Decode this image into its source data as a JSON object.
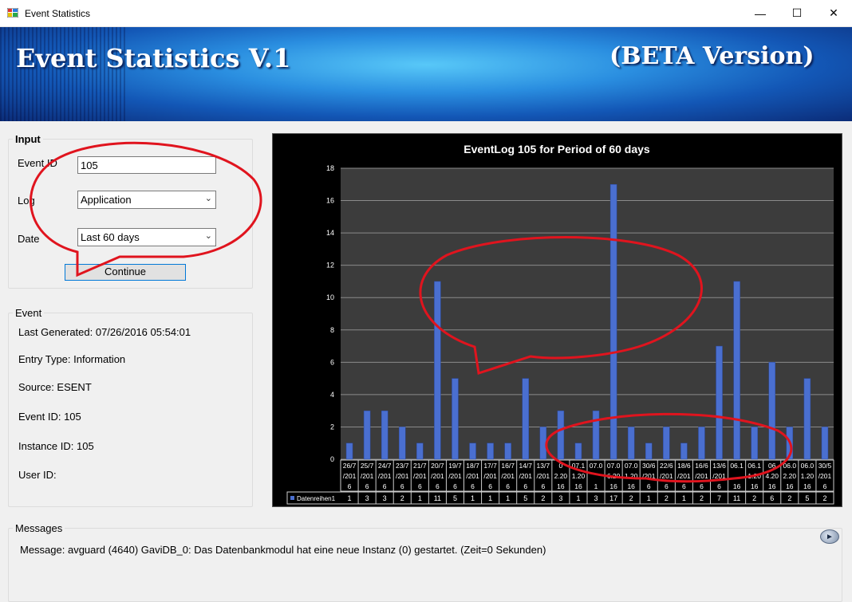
{
  "window": {
    "title": "Event Statistics",
    "controls": {
      "minimize": "—",
      "maximize": "☐",
      "close": "✕"
    }
  },
  "banner": {
    "title": "Event Statistics V.1",
    "beta": "(BETA Version)"
  },
  "input": {
    "legend": "Input",
    "event_id_label": "Event ID",
    "event_id_value": "105",
    "log_label": "Log",
    "log_value": "Application",
    "date_label": "Date",
    "date_value": "Last 60 days",
    "continue_label": "Continue"
  },
  "event": {
    "legend": "Event",
    "last_generated": "Last Generated: 07/26/2016 05:54:01",
    "entry_type": "Entry Type: Information",
    "source": "Source: ESENT",
    "event_id": "Event ID: 105",
    "instance_id": "Instance ID: 105",
    "user_id": "User ID:"
  },
  "messages": {
    "legend": "Messages",
    "text": "Message: avguard (4640) GaviDB_0: Das Datenbankmodul hat eine neue Instanz (0) gestartet. (Zeit=0 Sekunden)"
  },
  "colors": {
    "bar": "#4a6fd0",
    "annotation": "#e0141e",
    "chart_bg": "#3c3c3c"
  },
  "chart_data": {
    "type": "bar",
    "title": "EventLog 105 for Period of 60 days",
    "ylim": [
      0,
      18
    ],
    "yticks": [
      0,
      2,
      4,
      6,
      8,
      10,
      12,
      14,
      16,
      18
    ],
    "grid": true,
    "legend_position": "bottom-left data table",
    "series_name": "Datenreihen1",
    "categories": [
      [
        "26/7",
        "/201",
        "6"
      ],
      [
        "25/7",
        "/201",
        "6"
      ],
      [
        "24/7",
        "/201",
        "6"
      ],
      [
        "23/7",
        "/201",
        "6"
      ],
      [
        "21/7",
        "/201",
        "6"
      ],
      [
        "20/7",
        "/201",
        "6"
      ],
      [
        "19/7",
        "/201",
        "6"
      ],
      [
        "18/7",
        "/201",
        "6"
      ],
      [
        "17/7",
        "/201",
        "6"
      ],
      [
        "16/7",
        "/201",
        "6"
      ],
      [
        "14/7",
        "/201",
        "6"
      ],
      [
        "13/7",
        "/201",
        "6"
      ],
      [
        "0",
        "2.20",
        "16"
      ],
      [
        "07.1",
        "1.20",
        "16"
      ],
      [
        "07.0",
        "",
        "1"
      ],
      [
        "07.0",
        "6.20",
        "16"
      ],
      [
        "07.0",
        "1.20",
        "16"
      ],
      [
        "30/6",
        "/201",
        "6"
      ],
      [
        "22/6",
        "/201",
        "6"
      ],
      [
        "18/6",
        "/201",
        "6"
      ],
      [
        "16/6",
        "/201",
        "6"
      ],
      [
        "13/6",
        "/201",
        "6"
      ],
      [
        "06.1",
        "",
        "16"
      ],
      [
        "06.1",
        "1.20",
        "16"
      ],
      [
        "06",
        "4.20",
        "16"
      ],
      [
        "06.0",
        "2.20",
        "16"
      ],
      [
        "06.0",
        "1.20",
        "16"
      ],
      [
        "30/5",
        "/201",
        "6"
      ]
    ],
    "values": [
      1,
      3,
      3,
      2,
      1,
      11,
      5,
      1,
      1,
      1,
      5,
      2,
      3,
      1,
      3,
      17,
      2,
      1,
      2,
      1,
      2,
      7,
      11,
      2,
      6,
      2,
      5,
      2
    ]
  }
}
